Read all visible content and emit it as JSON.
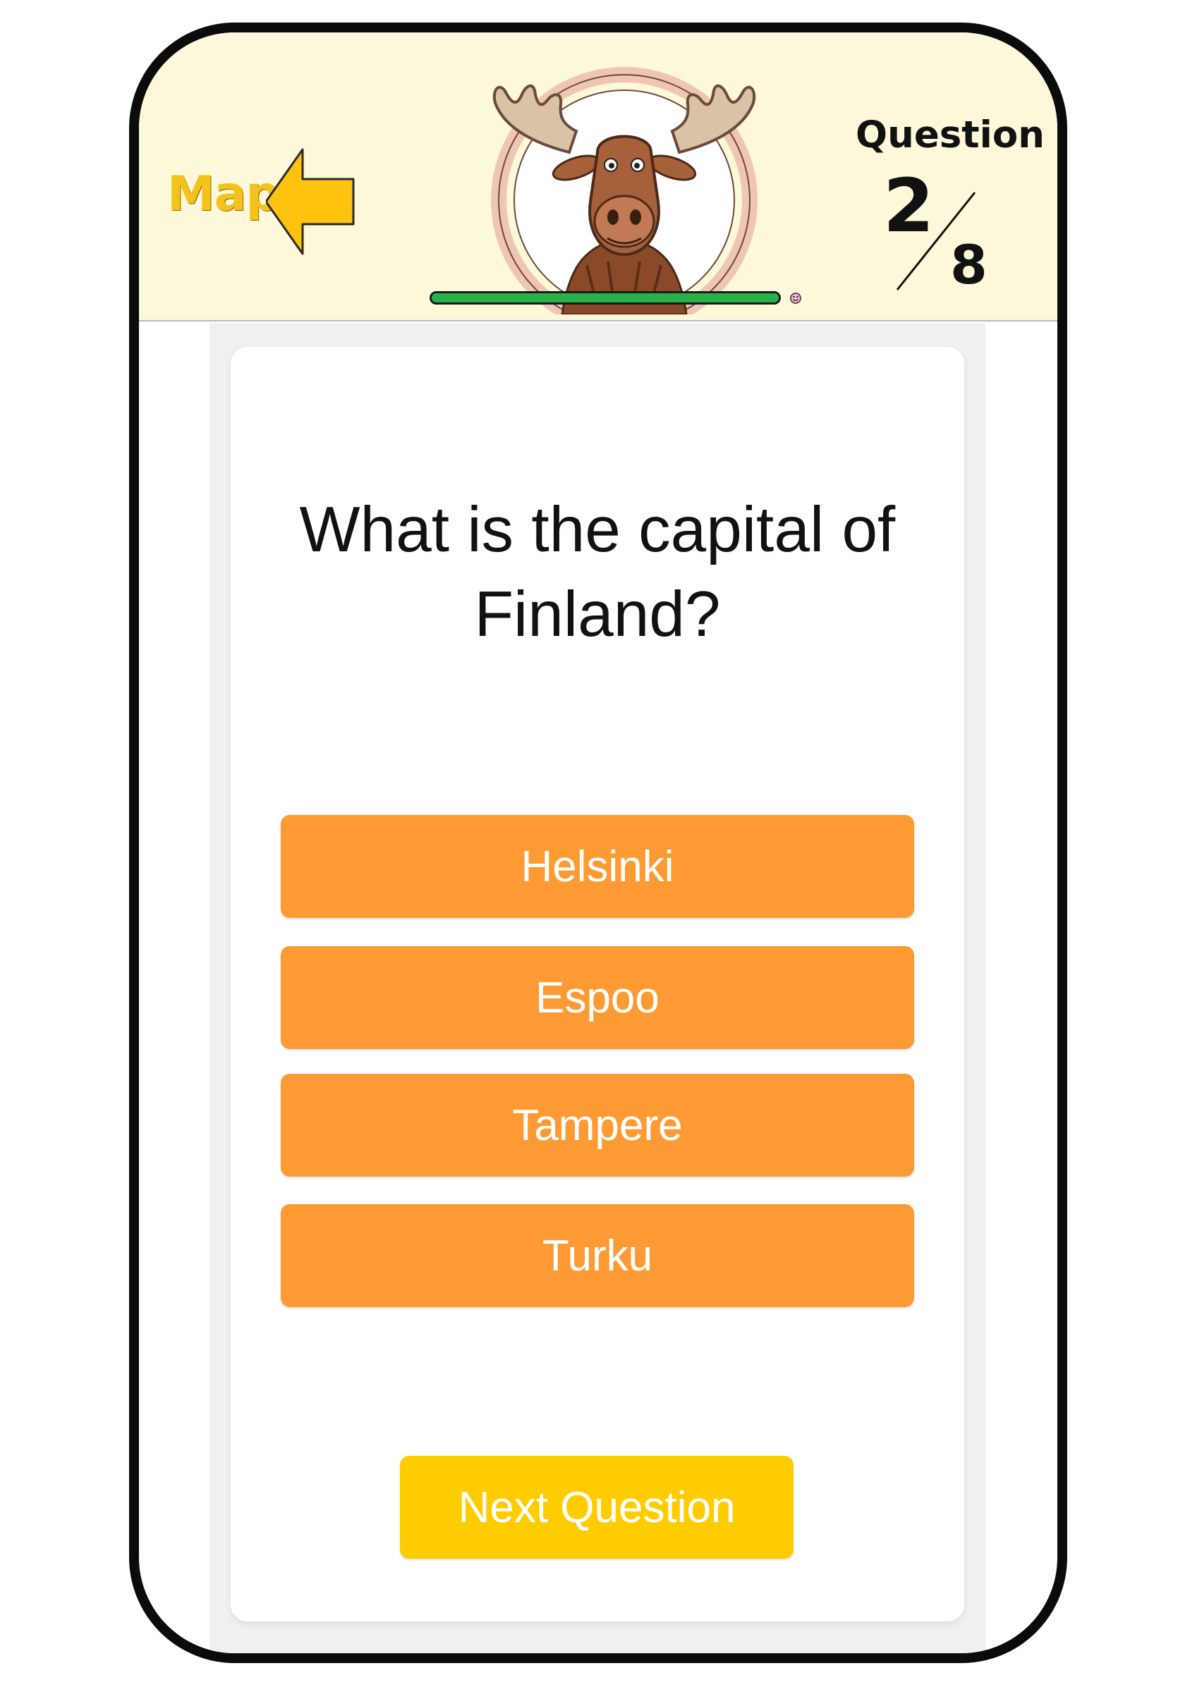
{
  "header": {
    "map_label": "Map",
    "mascot_icon": "moose-icon",
    "progress": {
      "fraction": 1.0,
      "color": "#28b24b"
    },
    "question_label": "Question",
    "question_current": "2",
    "question_total": "8"
  },
  "quiz": {
    "question_text": "What is the capital of Finland?",
    "answers": [
      {
        "label": "Helsinki"
      },
      {
        "label": "Espoo"
      },
      {
        "label": "Tampere"
      },
      {
        "label": "Turku"
      }
    ],
    "next_label": "Next Question"
  },
  "colors": {
    "header_bg": "#fdf8d9",
    "answer_bg": "#fd9a33",
    "next_bg": "#ffcc00",
    "map_accent": "#f4c21a"
  }
}
